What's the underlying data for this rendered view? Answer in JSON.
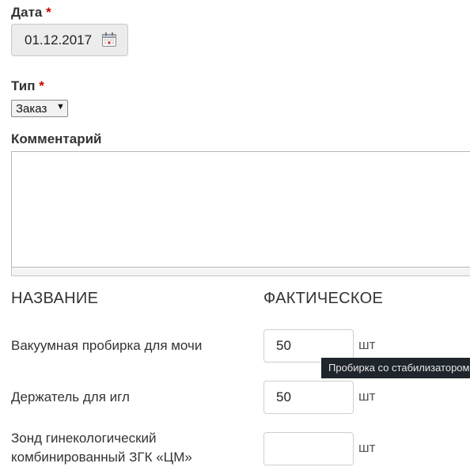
{
  "form": {
    "date_label": "Дата",
    "date_value": "01.12.2017",
    "required_mark": "*",
    "type_label": "Тип",
    "type_selected": "Заказ",
    "select_arrow": "▼",
    "comment_label": "Комментарий",
    "comment_value": ""
  },
  "table": {
    "headers": [
      "НАЗВАНИЕ",
      "ФАКТИЧЕСКОЕ"
    ],
    "rows": [
      {
        "name": "Вакуумная пробирка для мочи",
        "quantity": "50",
        "unit": "шт"
      },
      {
        "name": "Держатель для игл",
        "quantity": "50",
        "unit": "шт"
      },
      {
        "name_line1": "Зонд гинекологический",
        "name_line2": "комбинированный ЗГК «ЦМ»",
        "quantity": "",
        "unit": "шт"
      }
    ]
  },
  "tooltip": {
    "text": "Пробирка со стабилизатором"
  },
  "icons": {
    "calendar": "calendar-icon"
  }
}
